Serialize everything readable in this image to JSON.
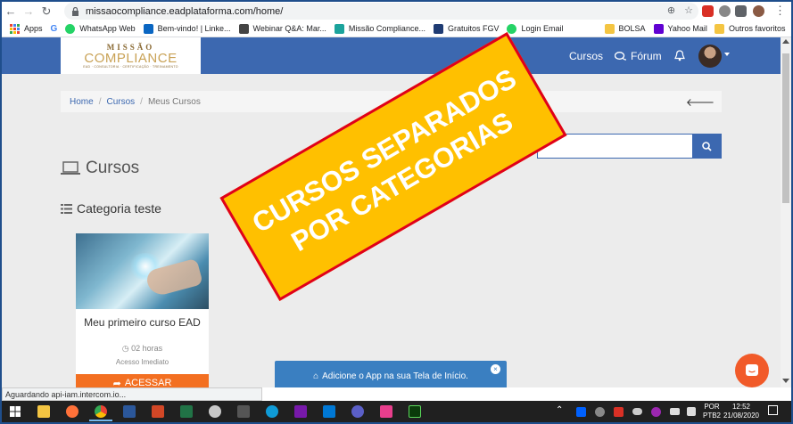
{
  "browser": {
    "url": "missaocompliance.eadplataforma.com/home/",
    "back": "←",
    "forward": "→",
    "reload": "↻",
    "bookmarks": [
      {
        "label": "Apps",
        "color": "#4285f4"
      },
      {
        "label": "",
        "color": "#4285f4",
        "icon": "G"
      },
      {
        "label": "WhatsApp Web",
        "color": "#25d366"
      },
      {
        "label": "Bem-vindo! | Linke...",
        "color": "#0a66c2"
      },
      {
        "label": "Webinar Q&A: Mar...",
        "color": "#444"
      },
      {
        "label": "Missão Compliance...",
        "color": "#1ba39c"
      },
      {
        "label": "Gratuitos FGV",
        "color": "#1f3b73"
      },
      {
        "label": "Login Email",
        "color": "#25d366"
      },
      {
        "label": "BOLSA",
        "color": "#f4c542"
      },
      {
        "label": "Yahoo Mail",
        "color": "#6001d2"
      }
    ],
    "other_bookmarks": "Outros favoritos",
    "status": "Aguardando api-iam.intercom.io..."
  },
  "site": {
    "logo_top": "MISSÃO",
    "logo_main": "COMPLIANCE",
    "logo_sub": "EAD · CONSULTORIA · CERTIFICAÇÃO · TREINAMENTO",
    "nav": {
      "cursos": "Cursos",
      "forum": "Fórum"
    },
    "breadcrumb": {
      "home": "Home",
      "cursos": "Cursos",
      "current": "Meus Cursos"
    },
    "page_title": "Cursos",
    "category_title": "Categoria teste",
    "course": {
      "title": "Meu primeiro curso EAD",
      "hours": "02 horas",
      "access": "Acesso Imediato",
      "button": "ACESSAR"
    },
    "app_banner": "Adicione o App na sua Tela de Início.",
    "app_banner_close": "×"
  },
  "promo": {
    "line1": "CURSOS SEPARADOS",
    "line2": "POR CATEGORIAS"
  },
  "taskbar": {
    "lang": "POR",
    "layout": "PTB2",
    "time": "12:52",
    "date": "21/08/2020"
  },
  "colors": {
    "navbar": "#3c68b0",
    "accent_orange": "#f36f21",
    "promo_fill": "#ffc000",
    "promo_border": "#e0001a"
  }
}
